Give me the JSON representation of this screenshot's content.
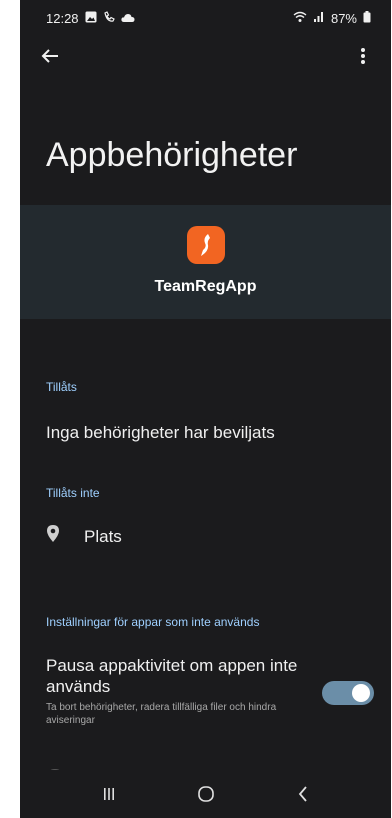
{
  "status_bar": {
    "time": "12:28",
    "battery_text": "87%",
    "icons": [
      "gallery-icon",
      "phone-icon",
      "cloud-icon",
      "wifi-icon",
      "signal-icon",
      "battery-icon"
    ]
  },
  "top_bar": {
    "back_icon": "back-arrow-icon",
    "menu_icon": "more-vert-icon"
  },
  "page": {
    "title": "Appbehörigheter"
  },
  "app": {
    "name": "TeamRegApp",
    "icon_color": "#f26522"
  },
  "sections": {
    "allowed_label": "Tillåts",
    "allowed_empty": "Inga behörigheter har beviljats",
    "not_allowed_label": "Tillåts inte",
    "not_allowed_items": [
      {
        "label": "Plats",
        "icon": "location-pin-icon"
      }
    ],
    "unused_label": "Inställningar för appar som inte används"
  },
  "pause_setting": {
    "title": "Pausa appaktivitet om appen inte används",
    "subtitle": "Ta bort behörigheter, radera tillfälliga filer och hindra aviseringar",
    "enabled": true
  },
  "nav_bar": {
    "items": [
      "recents-icon",
      "home-icon",
      "back-icon"
    ]
  },
  "colors": {
    "background": "#1b1b1d",
    "header_band": "#232a2f",
    "accent_label": "#9fd0ff",
    "toggle_track": "#6b8ea8"
  }
}
